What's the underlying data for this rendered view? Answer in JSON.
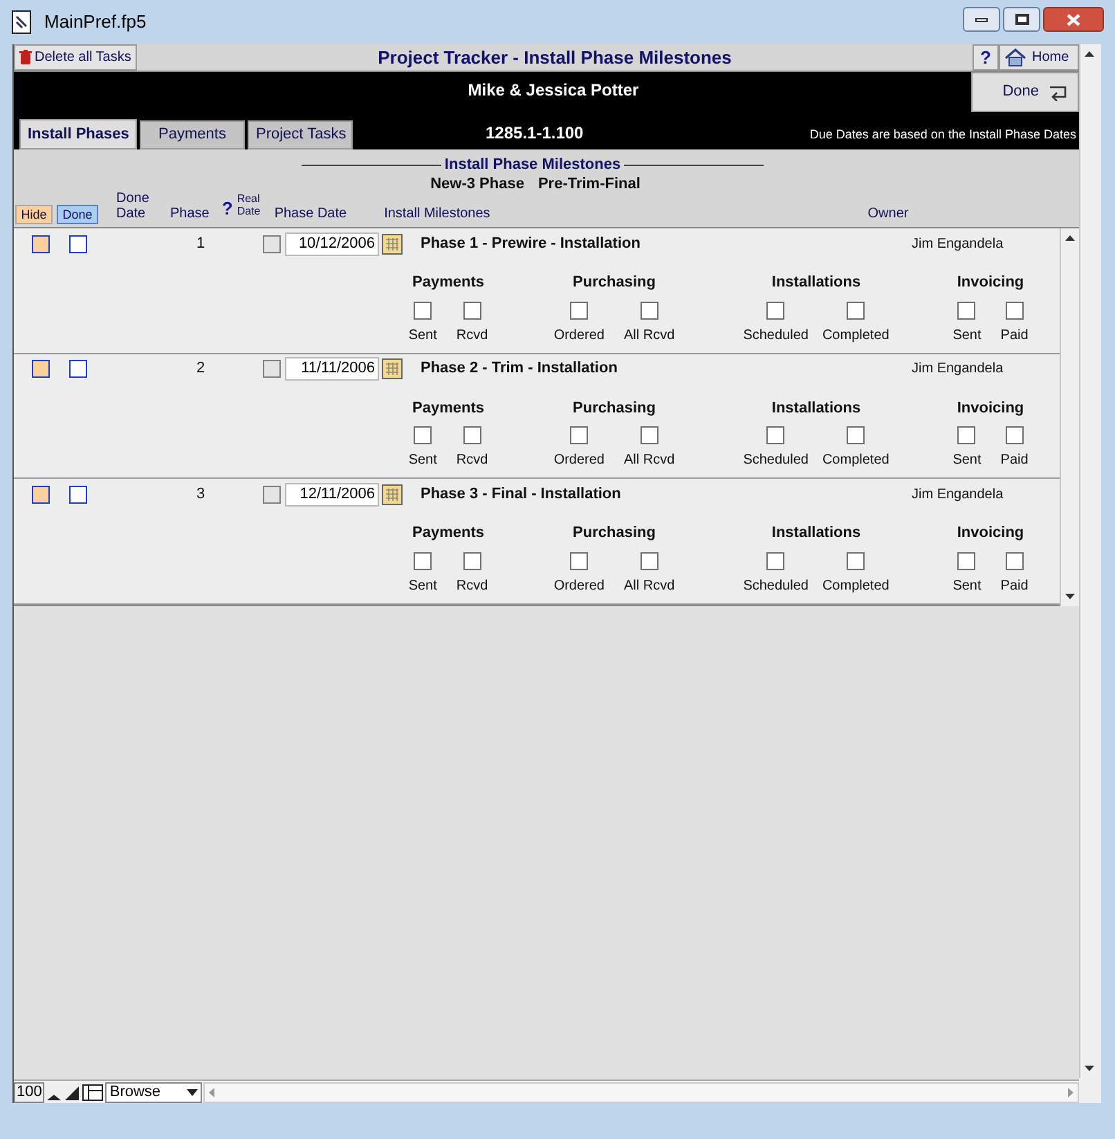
{
  "window": {
    "title": "MainPref.fp5"
  },
  "header": {
    "delete_button": "Delete all Tasks",
    "title": "Project Tracker - Install Phase Milestones",
    "help_button": "?",
    "home_button": "Home"
  },
  "client_name": "Mike & Jessica Potter",
  "done_button": "Done",
  "tabs": [
    {
      "label": "Install Phases",
      "selected": true
    },
    {
      "label": "Payments",
      "selected": false
    },
    {
      "label": "Project Tasks",
      "selected": false
    }
  ],
  "record_id": "1285.1-1.100",
  "due_note": "Due Dates are based on the Install Phase Dates",
  "section": {
    "title": "Install Phase Milestones",
    "phase_type": "New-3 Phase",
    "phase_set": "Pre-Trim-Final"
  },
  "columns": {
    "hide": "Hide",
    "done": "Done",
    "done_date": "Done Date",
    "phase": "Phase",
    "help": "?",
    "real_date": "Real Date",
    "phase_date": "Phase Date",
    "install_milestones": "Install Milestones",
    "owner": "Owner"
  },
  "phases": [
    {
      "hide": false,
      "done": false,
      "number": "1",
      "real_date": false,
      "date": "10/12/2006",
      "title": "Phase 1 - Prewire - Installation",
      "owner": "Jim Engandela",
      "groups": [
        {
          "title": "Payments",
          "items": [
            {
              "label": "Sent",
              "checked": false
            },
            {
              "label": "Rcvd",
              "checked": false
            }
          ]
        },
        {
          "title": "Purchasing",
          "items": [
            {
              "label": "Ordered",
              "checked": false
            },
            {
              "label": "All Rcvd",
              "checked": false
            }
          ]
        },
        {
          "title": "Installations",
          "items": [
            {
              "label": "Scheduled",
              "checked": false
            },
            {
              "label": "Completed",
              "checked": false
            }
          ]
        },
        {
          "title": "Invoicing",
          "items": [
            {
              "label": "Sent",
              "checked": false
            },
            {
              "label": "Paid",
              "checked": false
            }
          ]
        }
      ]
    },
    {
      "hide": false,
      "done": false,
      "number": "2",
      "real_date": false,
      "date": "11/11/2006",
      "title": "Phase 2 - Trim - Installation",
      "owner": "Jim Engandela",
      "groups": [
        {
          "title": "Payments",
          "items": [
            {
              "label": "Sent",
              "checked": false
            },
            {
              "label": "Rcvd",
              "checked": false
            }
          ]
        },
        {
          "title": "Purchasing",
          "items": [
            {
              "label": "Ordered",
              "checked": false
            },
            {
              "label": "All Rcvd",
              "checked": false
            }
          ]
        },
        {
          "title": "Installations",
          "items": [
            {
              "label": "Scheduled",
              "checked": false
            },
            {
              "label": "Completed",
              "checked": false
            }
          ]
        },
        {
          "title": "Invoicing",
          "items": [
            {
              "label": "Sent",
              "checked": false
            },
            {
              "label": "Paid",
              "checked": false
            }
          ]
        }
      ]
    },
    {
      "hide": false,
      "done": false,
      "number": "3",
      "real_date": false,
      "date": "12/11/2006",
      "title": "Phase 3 - Final - Installation",
      "owner": "Jim Engandela",
      "groups": [
        {
          "title": "Payments",
          "items": [
            {
              "label": "Sent",
              "checked": false
            },
            {
              "label": "Rcvd",
              "checked": false
            }
          ]
        },
        {
          "title": "Purchasing",
          "items": [
            {
              "label": "Ordered",
              "checked": false
            },
            {
              "label": "All Rcvd",
              "checked": false
            }
          ]
        },
        {
          "title": "Installations",
          "items": [
            {
              "label": "Scheduled",
              "checked": false
            },
            {
              "label": "Completed",
              "checked": false
            }
          ]
        },
        {
          "title": "Invoicing",
          "items": [
            {
              "label": "Sent",
              "checked": false
            },
            {
              "label": "Paid",
              "checked": false
            }
          ]
        }
      ]
    }
  ],
  "status_bar": {
    "zoom": "100",
    "mode": "Browse"
  }
}
